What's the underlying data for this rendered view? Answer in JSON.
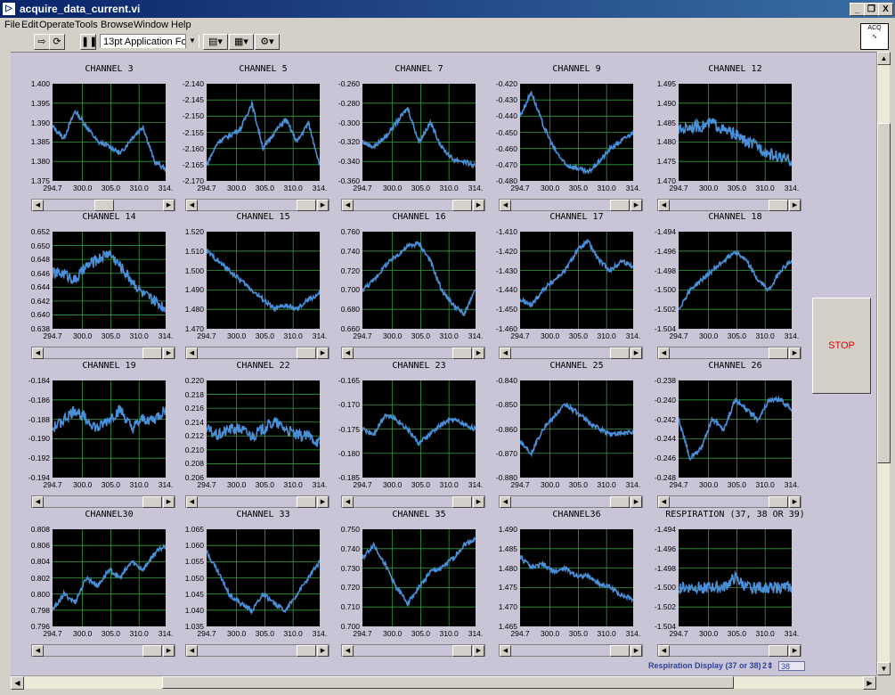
{
  "window": {
    "title": "acquire_data_current.vi",
    "app_icon": "labview-vi-icon",
    "controls": [
      "_",
      "❐",
      "X"
    ]
  },
  "menu": [
    "File",
    "Edit",
    "Operate",
    "Tools",
    "Browse",
    "Window",
    "Help"
  ],
  "toolbar": {
    "run_icon": "run-arrow-icon",
    "continuous_icon": "run-continuously-icon",
    "pause_icon": "pause-icon",
    "font": "13pt Application Font",
    "align_icon": "align-icon",
    "distribute_icon": "distribute-icon",
    "reorder_icon": "reorder-icon"
  },
  "acq_icon": {
    "label": "ACQ"
  },
  "stop_button": {
    "label": "STOP",
    "color": "#e00000"
  },
  "respiration_display": {
    "label": "Respiration Display (37 or 38)",
    "stepper": "2",
    "value": "38"
  },
  "colors": {
    "plot_bg": "#000000",
    "grid": "#2f9e3b",
    "trace": "#4a90d9",
    "panel": "#c9c5d6"
  },
  "chart_data": [
    {
      "title": "CHANNEL 3",
      "type": "line",
      "x_ticks": [
        "294.7",
        "300.0",
        "305.0",
        "310.0",
        "314."
      ],
      "y_ticks": [
        "1.400",
        "1.395",
        "1.390",
        "1.385",
        "1.380",
        "1.375"
      ],
      "ylim": [
        1.375,
        1.4
      ],
      "x": [
        294.7,
        296.7,
        298.7,
        300.7,
        302.7,
        304.7,
        306.7,
        308.7,
        310.7,
        312.7,
        314.7
      ],
      "values": [
        1.389,
        1.386,
        1.393,
        1.389,
        1.385,
        1.384,
        1.382,
        1.386,
        1.389,
        1.38,
        1.378
      ]
    },
    {
      "title": "CHANNEL 5",
      "type": "line",
      "x_ticks": [
        "294.7",
        "300.0",
        "305.0",
        "310.0",
        "314."
      ],
      "y_ticks": [
        "-2.140",
        "-2.145",
        "-2.150",
        "-2.155",
        "-2.160",
        "-2.165",
        "-2.170"
      ],
      "ylim": [
        -2.17,
        -2.14
      ],
      "x": [
        294.7,
        296.7,
        298.7,
        300.7,
        302.7,
        304.7,
        306.7,
        308.7,
        310.7,
        312.7,
        314.7
      ],
      "values": [
        -2.165,
        -2.158,
        -2.156,
        -2.154,
        -2.146,
        -2.16,
        -2.155,
        -2.151,
        -2.158,
        -2.152,
        -2.165
      ]
    },
    {
      "title": "CHANNEL 7",
      "type": "line",
      "x_ticks": [
        "294.7",
        "300.0",
        "305.0",
        "310.0",
        "314."
      ],
      "y_ticks": [
        "-0.260",
        "-0.280",
        "-0.300",
        "-0.320",
        "-0.340",
        "-0.360"
      ],
      "ylim": [
        -0.36,
        -0.26
      ],
      "x": [
        294.7,
        296.7,
        298.7,
        300.7,
        302.7,
        304.7,
        306.7,
        308.7,
        310.7,
        312.7,
        314.7
      ],
      "values": [
        -0.32,
        -0.325,
        -0.315,
        -0.3,
        -0.285,
        -0.32,
        -0.3,
        -0.325,
        -0.338,
        -0.34,
        -0.345
      ]
    },
    {
      "title": "CHANNEL 9",
      "type": "line",
      "x_ticks": [
        "294.7",
        "300.0",
        "305.0",
        "310.0",
        "314."
      ],
      "y_ticks": [
        "-0.420",
        "-0.430",
        "-0.440",
        "-0.450",
        "-0.460",
        "-0.470",
        "-0.480"
      ],
      "ylim": [
        -0.48,
        -0.42
      ],
      "x": [
        294.7,
        296.7,
        298.7,
        300.7,
        302.7,
        304.7,
        306.7,
        308.7,
        310.7,
        312.7,
        314.7
      ],
      "values": [
        -0.44,
        -0.425,
        -0.445,
        -0.46,
        -0.47,
        -0.472,
        -0.475,
        -0.468,
        -0.46,
        -0.455,
        -0.45
      ]
    },
    {
      "title": "CHANNEL 12",
      "type": "line",
      "x_ticks": [
        "294.7",
        "300.0",
        "305.0",
        "310.0",
        "314."
      ],
      "y_ticks": [
        "1.495",
        "1.490",
        "1.485",
        "1.480",
        "1.475",
        "1.470"
      ],
      "ylim": [
        1.47,
        1.495
      ],
      "x": [
        294.7,
        296.7,
        298.7,
        300.7,
        302.7,
        304.7,
        306.7,
        308.7,
        310.7,
        312.7,
        314.7
      ],
      "values": [
        1.483,
        1.484,
        1.484,
        1.485,
        1.483,
        1.482,
        1.48,
        1.479,
        1.477,
        1.476,
        1.475
      ]
    },
    {
      "title": "CHANNEL 14",
      "type": "line",
      "x_ticks": [
        "294.7",
        "300.0",
        "305.0",
        "310.0",
        "314."
      ],
      "y_ticks": [
        "0.652",
        "0.650",
        "0.648",
        "0.646",
        "0.644",
        "0.642",
        "0.640",
        "0.638"
      ],
      "ylim": [
        0.638,
        0.652
      ],
      "x": [
        294.7,
        296.7,
        298.7,
        300.7,
        302.7,
        304.7,
        306.7,
        308.7,
        310.7,
        312.7,
        314.7
      ],
      "values": [
        0.646,
        0.646,
        0.645,
        0.647,
        0.648,
        0.649,
        0.647,
        0.645,
        0.643,
        0.642,
        0.641
      ]
    },
    {
      "title": "CHANNEL 15",
      "type": "line",
      "x_ticks": [
        "294.7",
        "300.0",
        "305.0",
        "310.0",
        "314."
      ],
      "y_ticks": [
        "1.520",
        "1.510",
        "1.500",
        "1.490",
        "1.480",
        "1.470"
      ],
      "ylim": [
        1.47,
        1.52
      ],
      "x": [
        294.7,
        296.7,
        298.7,
        300.7,
        302.7,
        304.7,
        306.7,
        308.7,
        310.7,
        312.7,
        314.7
      ],
      "values": [
        1.51,
        1.505,
        1.5,
        1.495,
        1.49,
        1.485,
        1.48,
        1.482,
        1.48,
        1.485,
        1.488
      ]
    },
    {
      "title": "CHANNEL 16",
      "type": "line",
      "x_ticks": [
        "294.7",
        "300.0",
        "305.0",
        "310.0",
        "314."
      ],
      "y_ticks": [
        "0.760",
        "0.740",
        "0.720",
        "0.700",
        "0.680",
        "0.660"
      ],
      "ylim": [
        0.66,
        0.76
      ],
      "x": [
        294.7,
        296.7,
        298.7,
        300.7,
        302.7,
        304.7,
        306.7,
        308.7,
        310.7,
        312.7,
        314.7
      ],
      "values": [
        0.7,
        0.71,
        0.725,
        0.735,
        0.745,
        0.748,
        0.73,
        0.7,
        0.685,
        0.675,
        0.7
      ]
    },
    {
      "title": "CHANNEL 17",
      "type": "line",
      "x_ticks": [
        "294.7",
        "300.0",
        "305.0",
        "310.0",
        "314."
      ],
      "y_ticks": [
        "-1.410",
        "-1.420",
        "-1.430",
        "-1.440",
        "-1.450",
        "-1.460"
      ],
      "ylim": [
        -1.46,
        -1.41
      ],
      "x": [
        294.7,
        296.7,
        298.7,
        300.7,
        302.7,
        304.7,
        306.7,
        308.7,
        310.7,
        312.7,
        314.7
      ],
      "values": [
        -1.445,
        -1.448,
        -1.44,
        -1.435,
        -1.43,
        -1.42,
        -1.415,
        -1.425,
        -1.43,
        -1.425,
        -1.428
      ]
    },
    {
      "title": "CHANNEL 18",
      "type": "line",
      "x_ticks": [
        "294.7",
        "300.0",
        "305.0",
        "310.0",
        "314."
      ],
      "y_ticks": [
        "-1.494",
        "-1.496",
        "-1.498",
        "-1.500",
        "-1.502",
        "-1.504"
      ],
      "ylim": [
        -1.504,
        -1.494
      ],
      "x": [
        294.7,
        296.7,
        298.7,
        300.7,
        302.7,
        304.7,
        306.7,
        308.7,
        310.7,
        312.7,
        314.7
      ],
      "values": [
        -1.502,
        -1.5,
        -1.499,
        -1.498,
        -1.497,
        -1.496,
        -1.497,
        -1.499,
        -1.5,
        -1.498,
        -1.497
      ]
    },
    {
      "title": "CHANNEL 19",
      "type": "line",
      "x_ticks": [
        "294.7",
        "300.0",
        "305.0",
        "310.0",
        "314."
      ],
      "y_ticks": [
        "-0.184",
        "-0.186",
        "-0.188",
        "-0.190",
        "-0.192",
        "-0.194"
      ],
      "ylim": [
        -0.194,
        -0.184
      ],
      "x": [
        294.7,
        296.7,
        298.7,
        300.7,
        302.7,
        304.7,
        306.7,
        308.7,
        310.7,
        312.7,
        314.7
      ],
      "values": [
        -0.189,
        -0.188,
        -0.187,
        -0.188,
        -0.189,
        -0.188,
        -0.187,
        -0.189,
        -0.188,
        -0.188,
        -0.187
      ]
    },
    {
      "title": "CHANNEL 22",
      "type": "line",
      "x_ticks": [
        "294.7",
        "300.0",
        "305.0",
        "310.0",
        "314."
      ],
      "y_ticks": [
        "0.220",
        "0.218",
        "0.216",
        "0.214",
        "0.212",
        "0.210",
        "0.208",
        "0.206"
      ],
      "ylim": [
        0.206,
        0.22
      ],
      "x": [
        294.7,
        296.7,
        298.7,
        300.7,
        302.7,
        304.7,
        306.7,
        308.7,
        310.7,
        312.7,
        314.7
      ],
      "values": [
        0.213,
        0.212,
        0.213,
        0.213,
        0.212,
        0.213,
        0.214,
        0.213,
        0.212,
        0.212,
        0.211
      ]
    },
    {
      "title": "CHANNEL 23",
      "type": "line",
      "x_ticks": [
        "294.7",
        "300.0",
        "305.0",
        "310.0",
        "314."
      ],
      "y_ticks": [
        "-0.165",
        "-0.170",
        "-0.175",
        "-0.180",
        "-0.185"
      ],
      "ylim": [
        -0.185,
        -0.165
      ],
      "x": [
        294.7,
        296.7,
        298.7,
        300.7,
        302.7,
        304.7,
        306.7,
        308.7,
        310.7,
        312.7,
        314.7
      ],
      "values": [
        -0.175,
        -0.176,
        -0.172,
        -0.173,
        -0.175,
        -0.178,
        -0.176,
        -0.174,
        -0.173,
        -0.174,
        -0.175
      ]
    },
    {
      "title": "CHANNEL 25",
      "type": "line",
      "x_ticks": [
        "294.7",
        "300.0",
        "305.0",
        "310.0",
        "314."
      ],
      "y_ticks": [
        "-0.840",
        "-0.850",
        "-0.860",
        "-0.870",
        "-0.880"
      ],
      "ylim": [
        -0.88,
        -0.84
      ],
      "x": [
        294.7,
        296.7,
        298.7,
        300.7,
        302.7,
        304.7,
        306.7,
        308.7,
        310.7,
        312.7,
        314.7
      ],
      "values": [
        -0.865,
        -0.87,
        -0.86,
        -0.855,
        -0.85,
        -0.853,
        -0.857,
        -0.86,
        -0.862,
        -0.862,
        -0.861
      ]
    },
    {
      "title": "CHANNEL 26",
      "type": "line",
      "x_ticks": [
        "294.7",
        "300.0",
        "305.0",
        "310.0",
        "314."
      ],
      "y_ticks": [
        "-0.238",
        "-0.240",
        "-0.242",
        "-0.244",
        "-0.246",
        "-0.248"
      ],
      "ylim": [
        -0.248,
        -0.238
      ],
      "x": [
        294.7,
        296.7,
        298.7,
        300.7,
        302.7,
        304.7,
        306.7,
        308.7,
        310.7,
        312.7,
        314.7
      ],
      "values": [
        -0.242,
        -0.246,
        -0.245,
        -0.242,
        -0.243,
        -0.24,
        -0.241,
        -0.242,
        -0.24,
        -0.24,
        -0.241
      ]
    },
    {
      "title": "CHANNEL30",
      "type": "line",
      "x_ticks": [
        "294.7",
        "300.0",
        "305.0",
        "310.0",
        "314."
      ],
      "y_ticks": [
        "0.808",
        "0.806",
        "0.804",
        "0.802",
        "0.800",
        "0.798",
        "0.796"
      ],
      "ylim": [
        0.796,
        0.808
      ],
      "x": [
        294.7,
        296.7,
        298.7,
        300.7,
        302.7,
        304.7,
        306.7,
        308.7,
        310.7,
        312.7,
        314.7
      ],
      "values": [
        0.798,
        0.8,
        0.799,
        0.802,
        0.801,
        0.803,
        0.802,
        0.804,
        0.803,
        0.805,
        0.806
      ]
    },
    {
      "title": "CHANNEL 33",
      "type": "line",
      "x_ticks": [
        "294.7",
        "300.0",
        "305.0",
        "310.0",
        "314."
      ],
      "y_ticks": [
        "1.065",
        "1.060",
        "1.055",
        "1.050",
        "1.045",
        "1.040",
        "1.035"
      ],
      "ylim": [
        1.035,
        1.065
      ],
      "x": [
        294.7,
        296.7,
        298.7,
        300.7,
        302.7,
        304.7,
        306.7,
        308.7,
        310.7,
        312.7,
        314.7
      ],
      "values": [
        1.058,
        1.052,
        1.045,
        1.042,
        1.04,
        1.045,
        1.042,
        1.04,
        1.045,
        1.05,
        1.055
      ]
    },
    {
      "title": "CHANNEL 35",
      "type": "line",
      "x_ticks": [
        "294.7",
        "300.0",
        "305.0",
        "310.0",
        "314."
      ],
      "y_ticks": [
        "0.750",
        "0.740",
        "0.730",
        "0.720",
        "0.710",
        "0.700"
      ],
      "ylim": [
        0.7,
        0.75
      ],
      "x": [
        294.7,
        296.7,
        298.7,
        300.7,
        302.7,
        304.7,
        306.7,
        308.7,
        310.7,
        312.7,
        314.7
      ],
      "values": [
        0.735,
        0.742,
        0.732,
        0.72,
        0.712,
        0.72,
        0.728,
        0.73,
        0.735,
        0.742,
        0.745
      ]
    },
    {
      "title": "CHANNEL36",
      "type": "line",
      "x_ticks": [
        "294.7",
        "300.0",
        "305.0",
        "310.0",
        "314."
      ],
      "y_ticks": [
        "1.490",
        "1.485",
        "1.480",
        "1.475",
        "1.470",
        "1.465"
      ],
      "ylim": [
        1.465,
        1.49
      ],
      "x": [
        294.7,
        296.7,
        298.7,
        300.7,
        302.7,
        304.7,
        306.7,
        308.7,
        310.7,
        312.7,
        314.7
      ],
      "values": [
        1.483,
        1.48,
        1.481,
        1.479,
        1.48,
        1.478,
        1.478,
        1.476,
        1.475,
        1.473,
        1.472
      ]
    },
    {
      "title": "RESPIRATION (37, 38 OR 39)",
      "type": "line",
      "x_ticks": [
        "294.7",
        "300.0",
        "305.0",
        "310.0",
        "314."
      ],
      "y_ticks": [
        "-1.494",
        "-1.496",
        "-1.498",
        "-1.500",
        "-1.502",
        "-1.504"
      ],
      "ylim": [
        -1.504,
        -1.494
      ],
      "x": [
        294.7,
        296.7,
        298.7,
        300.7,
        302.7,
        304.7,
        306.7,
        308.7,
        310.7,
        312.7,
        314.7
      ],
      "values": [
        -1.5,
        -1.5,
        -1.5,
        -1.5,
        -1.5,
        -1.499,
        -1.5,
        -1.5,
        -1.5,
        -1.5,
        -1.5
      ]
    }
  ]
}
